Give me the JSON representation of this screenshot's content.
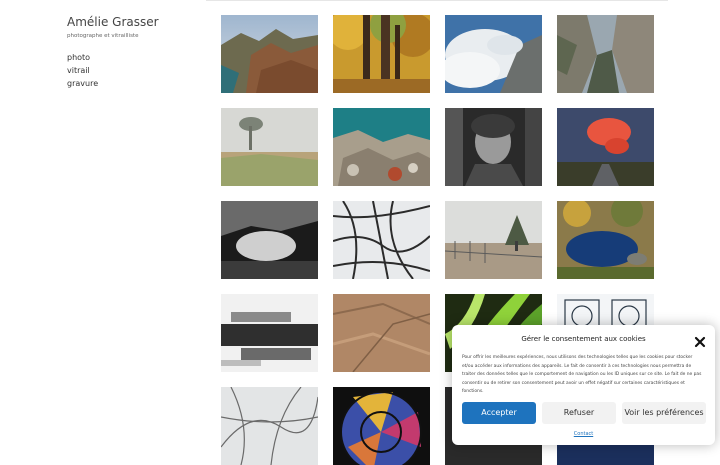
{
  "site": {
    "title": "Amélie Grasser",
    "tagline": "photographe et vitrailliste"
  },
  "nav": {
    "items": [
      {
        "label": "photo"
      },
      {
        "label": "vitrail"
      },
      {
        "label": "gravure"
      }
    ]
  },
  "gallery": {
    "thumbnails": [
      {
        "subject": "coastal-cliffs-sea"
      },
      {
        "subject": "autumn-forest-trees"
      },
      {
        "subject": "mountain-clouds"
      },
      {
        "subject": "canyon-gorge"
      },
      {
        "subject": "foggy-meadow-tree"
      },
      {
        "subject": "turquoise-sea-rocks"
      },
      {
        "subject": "black-white-portrait"
      },
      {
        "subject": "red-cloud-sunset"
      },
      {
        "subject": "dark-cave-rock"
      },
      {
        "subject": "bare-branches-sky"
      },
      {
        "subject": "frosted-field-fence"
      },
      {
        "subject": "mountain-lake-reflection"
      },
      {
        "subject": "abstract-blur-bw"
      },
      {
        "subject": "stone-texture"
      },
      {
        "subject": "green-leaves-closeup"
      },
      {
        "subject": "stained-glass-geometric"
      },
      {
        "subject": "snowy-branches"
      },
      {
        "subject": "stained-glass-colorful"
      },
      {
        "subject": "dark-photo"
      },
      {
        "subject": "stained-glass-blue"
      }
    ]
  },
  "consent": {
    "title": "Gérer le consentement aux cookies",
    "text": "Pour offrir les meilleures expériences, nous utilisons des technologies telles que les cookies pour stocker et/ou accéder aux informations des appareils. Le fait de consentir à ces technologies nous permettra de traiter des données telles que le comportement de navigation ou les ID uniques sur ce site. Le fait de ne pas consentir ou de retirer son consentement peut avoir un effet négatif sur certaines caractéristiques et fonctions.",
    "accept_label": "Accepter",
    "deny_label": "Refuser",
    "prefs_label": "Voir les préférences",
    "link_label": "Contact",
    "close_icon": "close-icon",
    "accent_color": "#1e73be"
  }
}
